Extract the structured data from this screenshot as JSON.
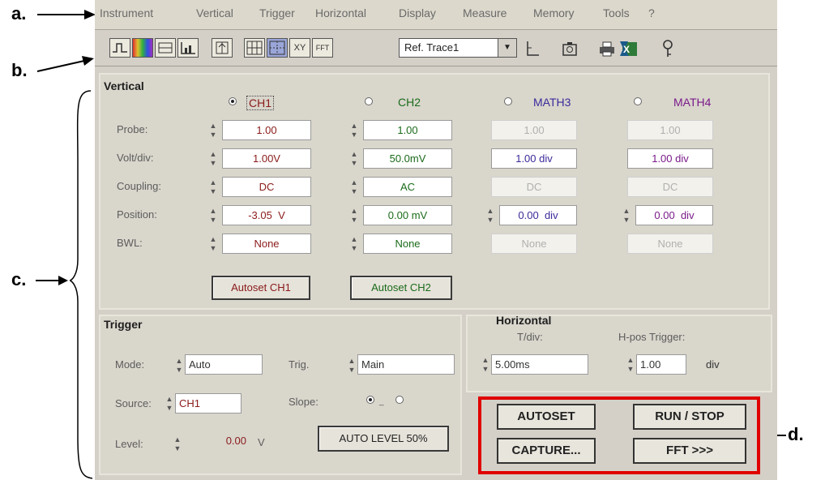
{
  "callouts": {
    "a": "a.",
    "b": "b.",
    "c": "c.",
    "d": "d."
  },
  "menu": [
    "Instrument",
    "Vertical",
    "Trigger",
    "Horizontal",
    "Display",
    "Measure",
    "Memory",
    "Tools",
    "?"
  ],
  "toolbar": {
    "icons": [
      "waveform-icon",
      "persistence-icon",
      "spectrum-icon",
      "histogram-icon",
      "cursor-icon",
      "grid-icon",
      "grid-dots-icon",
      "xy-mode-icon",
      "fft-mode-icon"
    ],
    "xy_label": "XY",
    "fft_label": "FFT",
    "ref_trace": "Ref. Trace1",
    "after_icons": [
      "axes-icon",
      "camera-icon",
      "printer-icon",
      "excel-icon",
      "help-icon"
    ]
  },
  "vertical": {
    "title": "Vertical",
    "channels": [
      "CH1",
      "CH2",
      "MATH3",
      "MATH4"
    ],
    "selected": "CH1",
    "rows": {
      "probe": {
        "label": "Probe:",
        "values": [
          "1.00",
          "1.00",
          "1.00",
          "1.00"
        ]
      },
      "voltdiv": {
        "label": "Volt/div:",
        "values": [
          "1.00V",
          "50.0mV",
          "1.00 div",
          "1.00 div"
        ]
      },
      "coupling": {
        "label": "Coupling:",
        "values": [
          "DC",
          "AC",
          "DC",
          "DC"
        ]
      },
      "position": {
        "label": "Position:",
        "values": [
          "-3.05",
          "0.00",
          "0.00",
          "0.00"
        ],
        "units": [
          "V",
          "mV",
          "div",
          "div"
        ]
      },
      "bwl": {
        "label": "BWL:",
        "values": [
          "None",
          "None",
          "None",
          "None"
        ]
      }
    },
    "autoset_ch1": "Autoset CH1",
    "autoset_ch2": "Autoset CH2",
    "colors": {
      "ch1": "#8a1a1a",
      "ch2": "#1a6b1a",
      "math3": "#3a2a9a",
      "math4": "#7a1a8a"
    }
  },
  "trigger": {
    "title": "Trigger",
    "mode_label": "Mode:",
    "mode": "Auto",
    "trig_label": "Trig.",
    "trig": "Main",
    "source_label": "Source:",
    "source": "CH1",
    "slope_label": "Slope:",
    "level_label": "Level:",
    "level": "0.00",
    "level_unit": "V",
    "auto_level": "AUTO LEVEL 50%"
  },
  "horizontal": {
    "title": "Horizontal",
    "tdiv_label": "T/div:",
    "tdiv": "5.00ms",
    "hpos_label": "H-pos Trigger:",
    "hpos": "1.00",
    "hpos_unit": "div"
  },
  "actions": {
    "autoset": "AUTOSET",
    "runstop": "RUN / STOP",
    "capture": "CAPTURE...",
    "fft": "FFT >>>"
  }
}
